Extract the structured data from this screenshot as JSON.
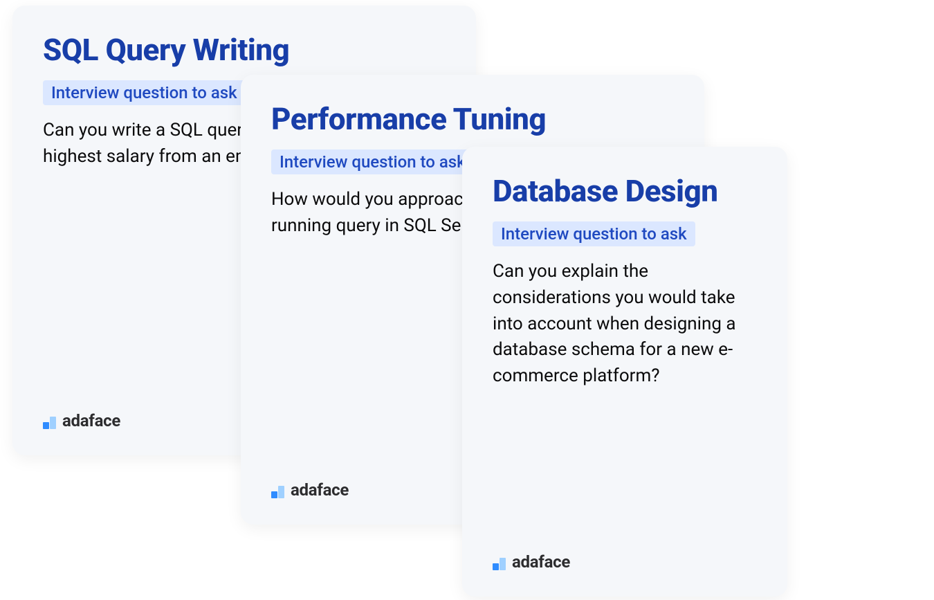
{
  "brand": "adaface",
  "tag_label": "Interview question to ask",
  "cards": [
    {
      "title": "SQL Query Writing",
      "question": "Can you write a SQL query to find the second highest salary from an employee table?"
    },
    {
      "title": "Performance Tuning",
      "question": "How would you approach optimizing a slow-running query in SQL Server?"
    },
    {
      "title": "Database Design",
      "question": "Can you explain the considerations you would take into account when designing a database schema for a new e-commerce platform?"
    }
  ]
}
